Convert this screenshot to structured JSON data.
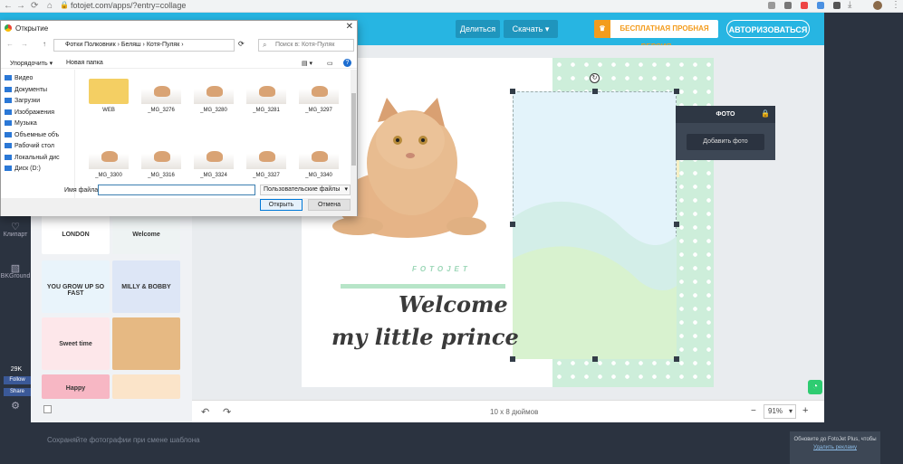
{
  "browser": {
    "url": "fotojet.com/apps/?entry=collage"
  },
  "header": {
    "share_label": "Делиться",
    "download_label": "Скачать",
    "trial_label": "БЕСПЛАТНАЯ ПРОБНАЯ ВЕРСИЯ",
    "login_label": "АВТОРИЗОВАТЬСЯ"
  },
  "rail": {
    "clipart_label": "Клипарт",
    "bg_label": "BKGround"
  },
  "social": {
    "likes": "29K",
    "follow_label": "Follow",
    "share_label": "Share"
  },
  "panel": {
    "thumbs": [
      {
        "label": "LONDON",
        "color": "#ffffff"
      },
      {
        "label": "Welcome",
        "color": "#eef3f3"
      },
      {
        "label": "YOU GROW UP SO FAST",
        "color": "#e9f4fb"
      },
      {
        "label": "MILLY & BOBBY",
        "color": "#dde6f6"
      },
      {
        "label": "Sweet time",
        "color": "#fde7ea"
      },
      {
        "label": "",
        "color": "#e6b983"
      },
      {
        "label": "Happy",
        "color": "#f7b7c4"
      },
      {
        "label": "",
        "color": "#fbe4c9"
      }
    ]
  },
  "canvas": {
    "brand": "FOTOJET",
    "line1": "Welcome",
    "line2": "my little prince",
    "size_label": "10 x 8 дюймов",
    "zoom_label": "91%"
  },
  "fotopanel": {
    "title": "ФОТО",
    "add_photo_label": "Добавить фото"
  },
  "tip": "Сохраняйте фотографии при смене шаблона",
  "notice": {
    "text": "Обновите до FotoJet Plus, чтобы",
    "link": "Удалить рекламу"
  },
  "dialog": {
    "title": "Открытие",
    "breadcrumb": "Фотки Полковник  ›  Беляш  ›  Котя-Пуляк  ›",
    "search_placeholder": "Поиск в: Котя-Пуляк",
    "organize_label": "Упорядочить ▾",
    "new_folder_label": "Новая папка",
    "tree": [
      "Видео",
      "Документы",
      "Загрузки",
      "Изображения",
      "Музыка",
      "Объемные объ",
      "Рабочий стол",
      "Локальный дис",
      "Диск (D:)"
    ],
    "files": [
      "WEB",
      "_MG_3276",
      "_MG_3280",
      "_MG_3281",
      "_MG_3297",
      "_MG_3300",
      "_MG_3316",
      "_MG_3324",
      "_MG_3327",
      "_MG_3340"
    ],
    "filename_label": "Имя файла:",
    "filetype_label": "Пользовательские файлы",
    "open_label": "Открыть",
    "cancel_label": "Отмена"
  },
  "colors": {
    "brand_blue": "#27b5e2",
    "trial_orange": "#f39c1d",
    "mint": "#cdeeda",
    "dark": "#2b3340"
  }
}
